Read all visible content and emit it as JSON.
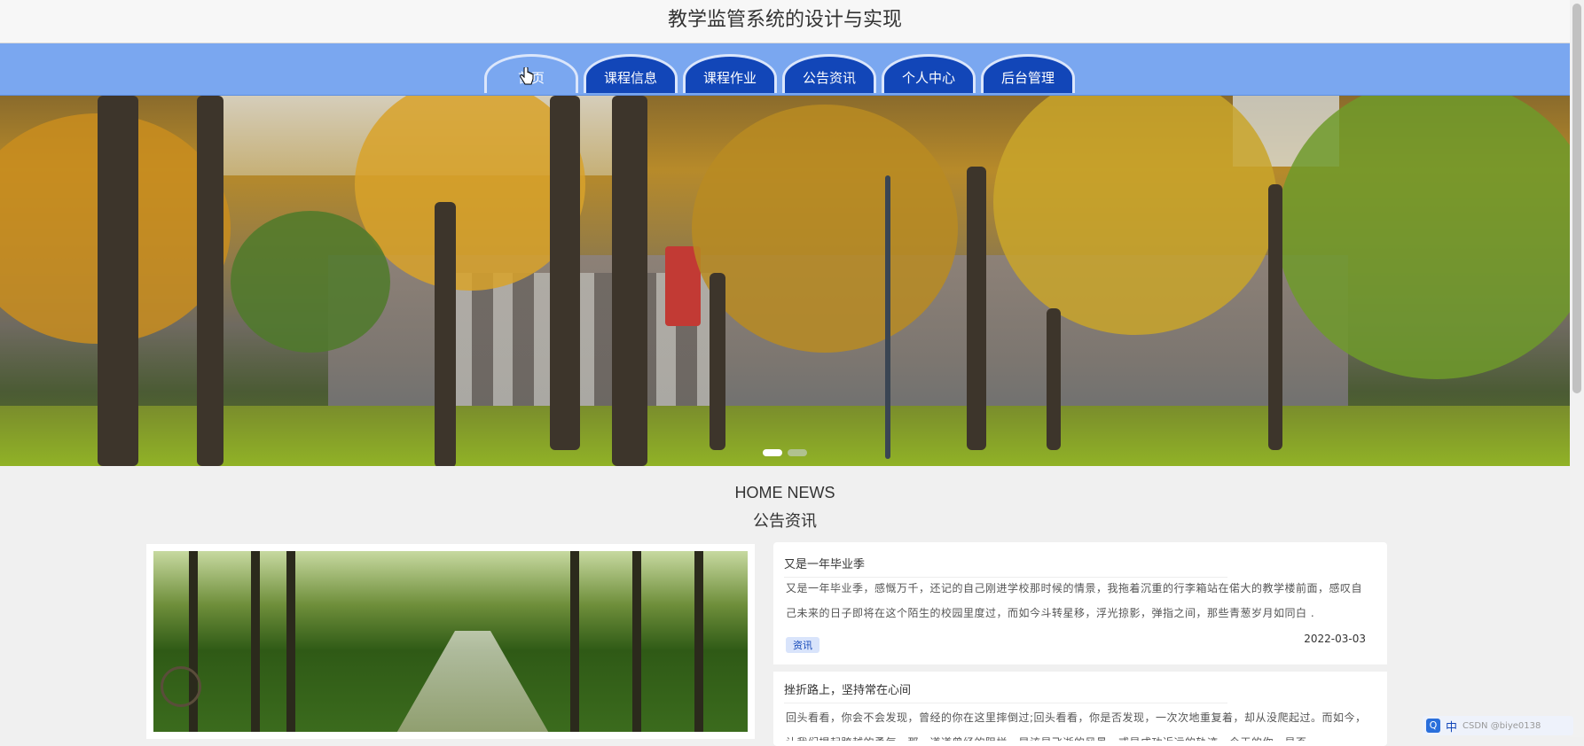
{
  "app": {
    "title": "教学监管系统的设计与实现"
  },
  "nav": {
    "items": [
      {
        "label": "首页",
        "active": true
      },
      {
        "label": "课程信息"
      },
      {
        "label": "课程作业"
      },
      {
        "label": "公告资讯"
      },
      {
        "label": "个人中心"
      },
      {
        "label": "后台管理"
      }
    ]
  },
  "banner": {
    "slide_count": 2,
    "active_slide": 1
  },
  "news_section": {
    "title_en": "HOME NEWS",
    "title_zh": "公告资讯"
  },
  "news": [
    {
      "title": "又是一年毕业季",
      "text": "又是一年毕业季，感慨万千，还记的自己刚进学校那时候的情景，我拖着沉重的行李箱站在偌大的教学楼前面，感叹自己未来的日子即将在这个陌生的校园里度过，而如今斗转星移，浮光掠影，弹指之间，那些青葱岁月如同白 .",
      "tag": "资讯",
      "date": "2022-03-03"
    },
    {
      "title": "挫折路上，坚持常在心间",
      "text": "回头看看，你会不会发现，曾经的你在这里摔倒过;回头看看，你是否发现，一次次地重复着，却从没爬起过。而如今，让我们提起跨越的勇气，那一道道曾经的阻拦，早该是飞逝的风景，或是成功近远的轨迹，今天的你，是否"
    }
  ],
  "ime": {
    "q": "Q",
    "lang": "中",
    "watermark": "CSDN @biye0138"
  }
}
